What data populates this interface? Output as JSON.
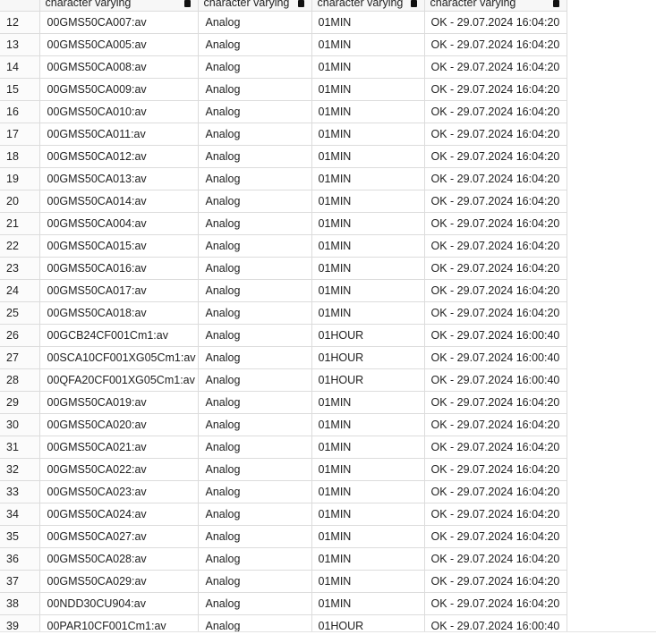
{
  "grid": {
    "columns": [
      {
        "type": "character varying"
      },
      {
        "type": "character varying"
      },
      {
        "type": "character varying"
      },
      {
        "type": "character varying"
      }
    ],
    "rows": [
      {
        "num": "12",
        "name": "00GMS50CA007:av",
        "kind": "Analog",
        "interval": "01MIN",
        "status": "OK - 29.07.2024 16:04:20"
      },
      {
        "num": "13",
        "name": "00GMS50CA005:av",
        "kind": "Analog",
        "interval": "01MIN",
        "status": "OK - 29.07.2024 16:04:20"
      },
      {
        "num": "14",
        "name": "00GMS50CA008:av",
        "kind": "Analog",
        "interval": "01MIN",
        "status": "OK - 29.07.2024 16:04:20"
      },
      {
        "num": "15",
        "name": "00GMS50CA009:av",
        "kind": "Analog",
        "interval": "01MIN",
        "status": "OK - 29.07.2024 16:04:20"
      },
      {
        "num": "16",
        "name": "00GMS50CA010:av",
        "kind": "Analog",
        "interval": "01MIN",
        "status": "OK - 29.07.2024 16:04:20"
      },
      {
        "num": "17",
        "name": "00GMS50CA011:av",
        "kind": "Analog",
        "interval": "01MIN",
        "status": "OK - 29.07.2024 16:04:20"
      },
      {
        "num": "18",
        "name": "00GMS50CA012:av",
        "kind": "Analog",
        "interval": "01MIN",
        "status": "OK - 29.07.2024 16:04:20"
      },
      {
        "num": "19",
        "name": "00GMS50CA013:av",
        "kind": "Analog",
        "interval": "01MIN",
        "status": "OK - 29.07.2024 16:04:20"
      },
      {
        "num": "20",
        "name": "00GMS50CA014:av",
        "kind": "Analog",
        "interval": "01MIN",
        "status": "OK - 29.07.2024 16:04:20"
      },
      {
        "num": "21",
        "name": "00GMS50CA004:av",
        "kind": "Analog",
        "interval": "01MIN",
        "status": "OK - 29.07.2024 16:04:20"
      },
      {
        "num": "22",
        "name": "00GMS50CA015:av",
        "kind": "Analog",
        "interval": "01MIN",
        "status": "OK - 29.07.2024 16:04:20"
      },
      {
        "num": "23",
        "name": "00GMS50CA016:av",
        "kind": "Analog",
        "interval": "01MIN",
        "status": "OK - 29.07.2024 16:04:20"
      },
      {
        "num": "24",
        "name": "00GMS50CA017:av",
        "kind": "Analog",
        "interval": "01MIN",
        "status": "OK - 29.07.2024 16:04:20"
      },
      {
        "num": "25",
        "name": "00GMS50CA018:av",
        "kind": "Analog",
        "interval": "01MIN",
        "status": "OK - 29.07.2024 16:04:20"
      },
      {
        "num": "26",
        "name": "00GCB24CF001Cm1:av",
        "kind": "Analog",
        "interval": "01HOUR",
        "status": "OK - 29.07.2024 16:00:40"
      },
      {
        "num": "27",
        "name": "00SCA10CF001XG05Cm1:av",
        "kind": "Analog",
        "interval": "01HOUR",
        "status": "OK - 29.07.2024 16:00:40"
      },
      {
        "num": "28",
        "name": "00QFA20CF001XG05Cm1:av",
        "kind": "Analog",
        "interval": "01HOUR",
        "status": "OK - 29.07.2024 16:00:40"
      },
      {
        "num": "29",
        "name": "00GMS50CA019:av",
        "kind": "Analog",
        "interval": "01MIN",
        "status": "OK - 29.07.2024 16:04:20"
      },
      {
        "num": "30",
        "name": "00GMS50CA020:av",
        "kind": "Analog",
        "interval": "01MIN",
        "status": "OK - 29.07.2024 16:04:20"
      },
      {
        "num": "31",
        "name": "00GMS50CA021:av",
        "kind": "Analog",
        "interval": "01MIN",
        "status": "OK - 29.07.2024 16:04:20"
      },
      {
        "num": "32",
        "name": "00GMS50CA022:av",
        "kind": "Analog",
        "interval": "01MIN",
        "status": "OK - 29.07.2024 16:04:20"
      },
      {
        "num": "33",
        "name": "00GMS50CA023:av",
        "kind": "Analog",
        "interval": "01MIN",
        "status": "OK - 29.07.2024 16:04:20"
      },
      {
        "num": "34",
        "name": "00GMS50CA024:av",
        "kind": "Analog",
        "interval": "01MIN",
        "status": "OK - 29.07.2024 16:04:20"
      },
      {
        "num": "35",
        "name": "00GMS50CA027:av",
        "kind": "Analog",
        "interval": "01MIN",
        "status": "OK - 29.07.2024 16:04:20"
      },
      {
        "num": "36",
        "name": "00GMS50CA028:av",
        "kind": "Analog",
        "interval": "01MIN",
        "status": "OK - 29.07.2024 16:04:20"
      },
      {
        "num": "37",
        "name": "00GMS50CA029:av",
        "kind": "Analog",
        "interval": "01MIN",
        "status": "OK - 29.07.2024 16:04:20"
      },
      {
        "num": "38",
        "name": "00NDD30CU904:av",
        "kind": "Analog",
        "interval": "01MIN",
        "status": "OK - 29.07.2024 16:04:20"
      },
      {
        "num": "39",
        "name": "00PAR10CF001Cm1:av",
        "kind": "Analog",
        "interval": "01HOUR",
        "status": "OK - 29.07.2024 16:00:40"
      }
    ]
  },
  "icons": {
    "column_sort": "sort-icon"
  }
}
